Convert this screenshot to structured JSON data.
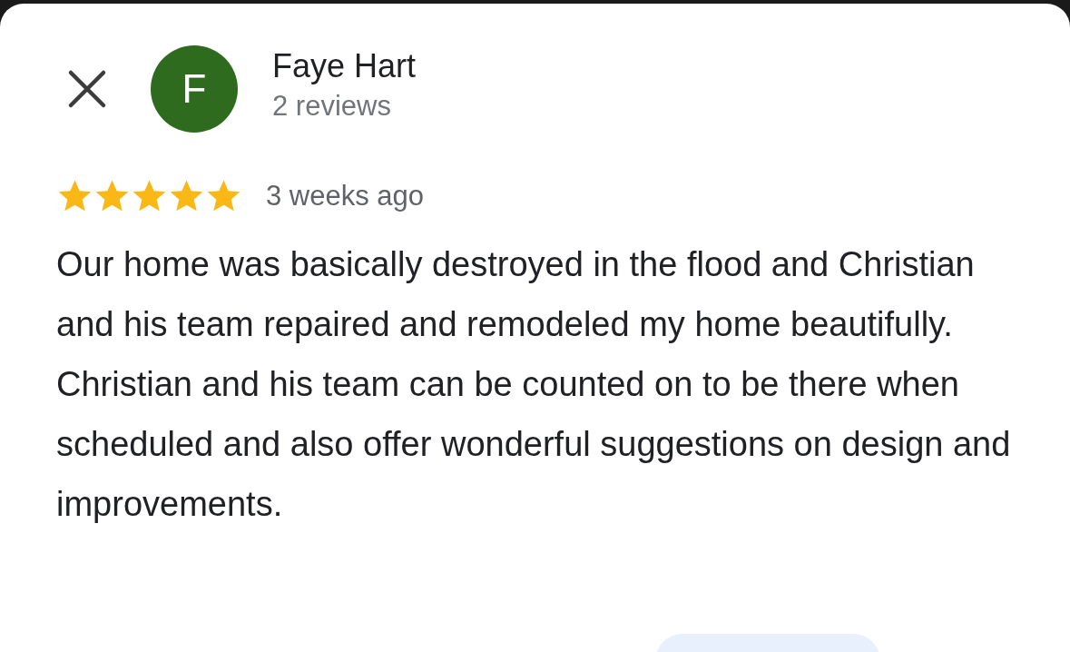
{
  "reviewer": {
    "initial": "F",
    "name": "Faye Hart",
    "review_count": "2 reviews"
  },
  "review": {
    "stars": 5,
    "time": "3 weeks ago",
    "text": "Our home was basically destroyed in the flood and Christian and his team repaired and remodeled my home beautifully.  Christian and his team can be counted on to be there when scheduled and also offer wonderful suggestions on design and improvements."
  }
}
